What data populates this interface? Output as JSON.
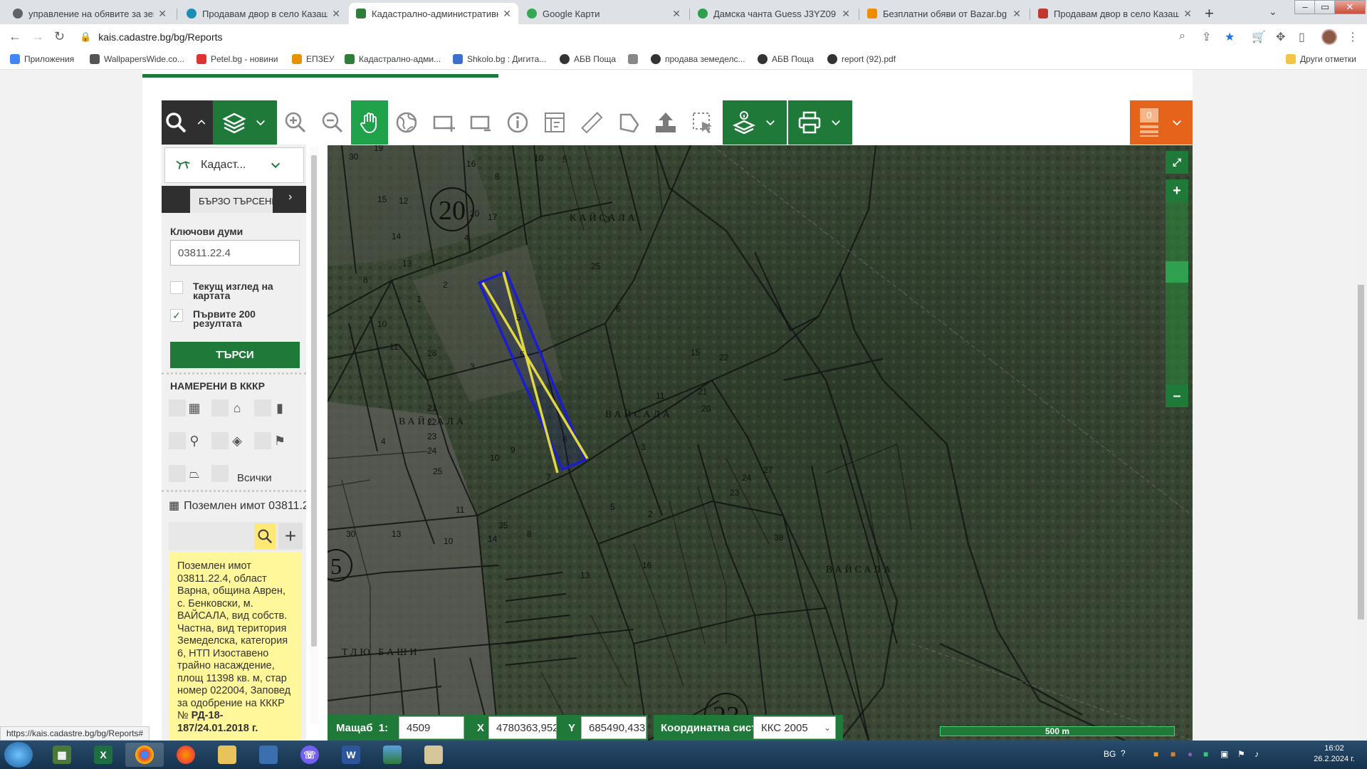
{
  "browser": {
    "tabs": [
      {
        "title": "управление на обявите за земе",
        "color": "#5f6368",
        "active": false
      },
      {
        "title": "Продавам двор в село Казашка",
        "color": "#1b8fb3",
        "active": false
      },
      {
        "title": "Кадастрално-административна",
        "color": "#2f7d3b",
        "active": true
      },
      {
        "title": "Google Карти",
        "color": "#34a853",
        "active": false
      },
      {
        "title": "Дамска чанта Guess J3YZ09 WF",
        "color": "#2e9e4f",
        "active": false
      },
      {
        "title": "Безплатни обяви от Bazar.bg –",
        "color": "#f08c00",
        "active": false
      },
      {
        "title": "Продавам двор в село Казашка",
        "color": "#c0392b",
        "active": false
      }
    ],
    "url": "kais.cadastre.bg/bg/Reports",
    "bookmarks": [
      {
        "label": "Приложения",
        "color": "#4285f4"
      },
      {
        "label": "WallpapersWide.co...",
        "color": "#555555"
      },
      {
        "label": "Petel.bg - новини",
        "color": "#d33"
      },
      {
        "label": "ЕПЗЕУ",
        "color": "#e59400"
      },
      {
        "label": "Кадастрално-адми...",
        "color": "#2f7d3b"
      },
      {
        "label": "Shkolo.bg : Дигита...",
        "color": "#3b6fd1"
      },
      {
        "label": "АБВ Поща",
        "color": "#333333"
      },
      {
        "label": "",
        "color": "#888888"
      },
      {
        "label": "продава земеделс...",
        "color": "#333333"
      },
      {
        "label": "АБВ Поща",
        "color": "#333333"
      },
      {
        "label": "report (92).pdf",
        "color": "#333333"
      }
    ],
    "other_bookmarks": "Други отметки",
    "status_url": "https://kais.cadastre.bg/bg/Reports#"
  },
  "toolbar": {
    "icons": [
      "search-icon",
      "collapse-icon",
      "layers-icon",
      "zoom-in-icon",
      "zoom-out-icon",
      "pan-hand-icon",
      "globe-icon",
      "add-rect-icon",
      "select-rect-icon",
      "info-icon",
      "measure-table-icon",
      "ruler-icon",
      "polygon-icon",
      "upload-icon",
      "select-area-icon",
      "identify-layers-icon",
      "print-icon"
    ],
    "badge_count": "0"
  },
  "panel": {
    "layer_select": "Кадаст...",
    "quick_search_tab": "БЪРЗО ТЪРСЕНЕ",
    "keywords_label": "Ключови думи",
    "keywords_value": "03811.22.4",
    "current_view_label": "Текущ изглед на картата",
    "current_view_checked": false,
    "first200_label": "Първите 200 резултата",
    "first200_checked": true,
    "search_button": "ТЪРСИ",
    "found_title": "НАМЕРЕНИ В КККР",
    "filter_all": "Всички",
    "result_title": "Поземлен имот 03811.22.4",
    "result_text": "Поземлен имот 03811.22.4, област Варна, община Аврен, с. Бенковски, м. ВАЙСАЛА, вид собств. Частна, вид територия Земеделска, категория 6, НТП Изоставено трайно насаждение, площ 11398 кв. м, стар номер 022004, Заповед за одобрение на КККР № ",
    "result_order": "РД-18-187/24.01.2018 г."
  },
  "map": {
    "scale_label": "Мащаб",
    "scale_prefix": "1:",
    "scale_value": "4509",
    "x_label": "X",
    "x_value": "4780363,952",
    "y_label": "Y",
    "y_value": "685490,433",
    "crs_label": "Координатна система",
    "crs_value": "ККС 2005",
    "scalebar": "500 m",
    "locality_names": [
      "ВАЙСАЛА",
      "ВАЙСАЛА",
      "ВАЙСАЛА",
      "ТЛЮ БАШИ",
      "КАЙСАЛА"
    ],
    "parcel_numbers": [
      "30",
      "19",
      "16",
      "8",
      "10",
      "5",
      "20",
      "17",
      "3",
      "15",
      "12",
      "14",
      "13",
      "4",
      "2",
      "1",
      "8",
      "10",
      "11",
      "28",
      "3",
      "5",
      "25",
      "6",
      "5",
      "21",
      "22",
      "23",
      "24",
      "25",
      "4",
      "10",
      "9",
      "7",
      "11",
      "35",
      "14",
      "30",
      "13",
      "10",
      "15",
      "6",
      "8",
      "3",
      "2",
      "21",
      "20",
      "22",
      "27",
      "24",
      "23",
      "38",
      "16",
      "13",
      "11",
      "5"
    ],
    "map_circle_numbers": [
      "20",
      "5",
      "23"
    ]
  },
  "taskbar": {
    "language": "BG",
    "time": "16:02",
    "date": "26.2.2024 г."
  }
}
